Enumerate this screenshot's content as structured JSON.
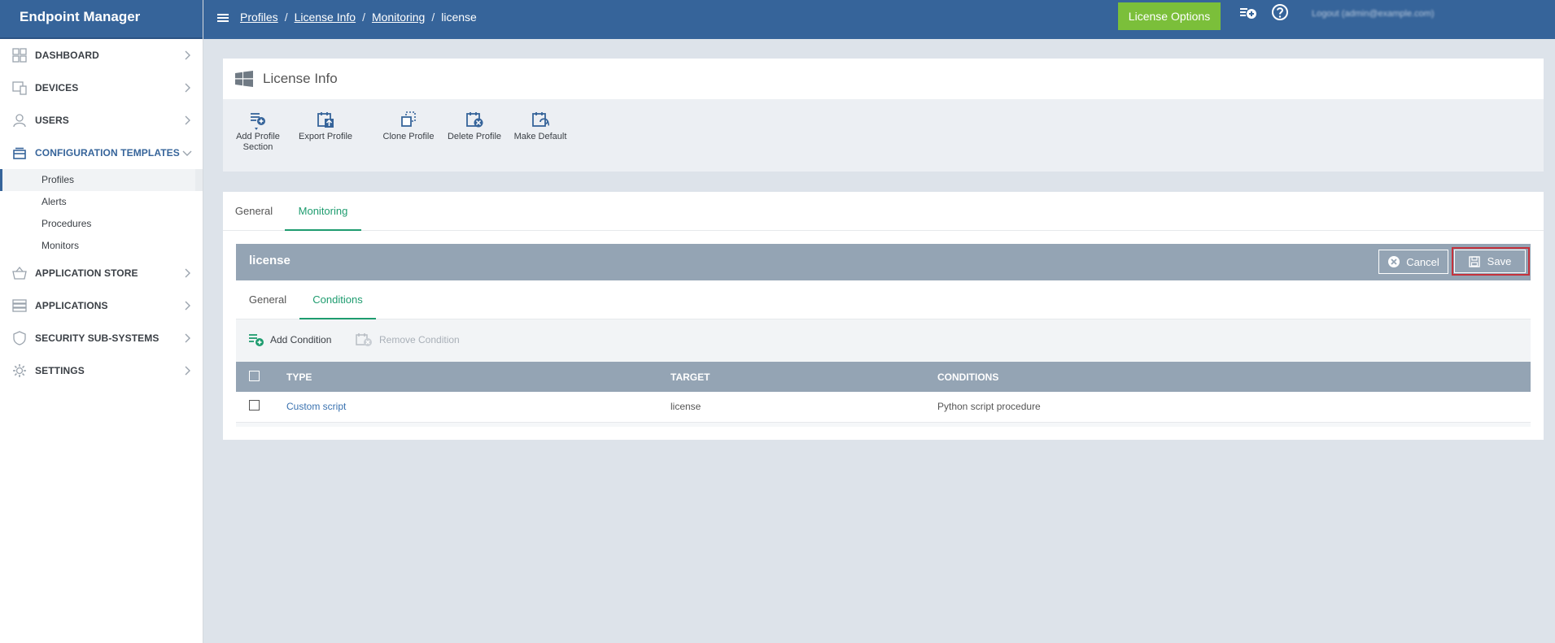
{
  "brand": "Endpoint Manager",
  "sidebar": {
    "items": [
      {
        "label": "DASHBOARD",
        "icon": "dashboard-icon"
      },
      {
        "label": "DEVICES",
        "icon": "devices-icon"
      },
      {
        "label": "USERS",
        "icon": "user-icon"
      },
      {
        "label": "CONFIGURATION TEMPLATES",
        "icon": "templates-icon"
      },
      {
        "label": "APPLICATION STORE",
        "icon": "store-basket-icon"
      },
      {
        "label": "APPLICATIONS",
        "icon": "applications-icon"
      },
      {
        "label": "SECURITY SUB-SYSTEMS",
        "icon": "shield-icon"
      },
      {
        "label": "SETTINGS",
        "icon": "gear-icon"
      }
    ],
    "sub_items": [
      "Profiles",
      "Alerts",
      "Procedures",
      "Monitors"
    ]
  },
  "header": {
    "breadcrumbs": [
      "Profiles",
      "License Info",
      "Monitoring"
    ],
    "breadcrumb_sep": "/",
    "breadcrumb_current": "license",
    "license_options": "License Options",
    "logout": "Logout (admin@example.com)"
  },
  "profile": {
    "title": "License Info",
    "toolbar": [
      {
        "label": "Add Profile Section"
      },
      {
        "label": "Export Profile"
      },
      {
        "label": "Clone Profile"
      },
      {
        "label": "Delete Profile"
      },
      {
        "label": "Make Default"
      }
    ]
  },
  "tabs": [
    "General",
    "Monitoring"
  ],
  "monitor": {
    "title": "license",
    "cancel": "Cancel",
    "save": "Save",
    "subtabs": [
      "General",
      "Conditions"
    ],
    "add_condition": "Add Condition",
    "remove_condition": "Remove Condition",
    "columns": [
      "TYPE",
      "TARGET",
      "CONDITIONS"
    ],
    "rows": [
      {
        "type": "Custom script",
        "target": "license",
        "conditions": "Python script procedure"
      }
    ]
  },
  "colors": {
    "brand": "#36649a",
    "accent": "#1e9c6f",
    "license_btn": "#7bbf3a",
    "save_highlight": "#c4323c"
  }
}
